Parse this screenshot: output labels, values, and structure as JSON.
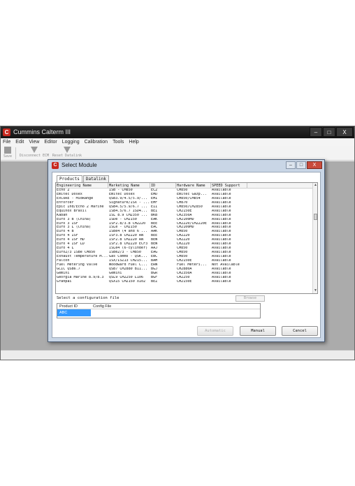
{
  "app": {
    "title": "Cummins Calterm III",
    "window_buttons": {
      "minimize": "‒",
      "maximize": "□",
      "close": "X"
    }
  },
  "menu": [
    "File",
    "Edit",
    "View",
    "Editor",
    "Logging",
    "Calibration",
    "Tools",
    "Help"
  ],
  "toolbar": {
    "save_label": "Save",
    "disconnect_label": "Disconnect ECM",
    "reset_label": "Reset Datalink"
  },
  "dialog": {
    "title": "Select Module",
    "tabs": [
      "Products",
      "Datalink"
    ],
    "columns": [
      "Engineering Name",
      "Marketing Name",
      "ID",
      "Hardware Name",
      "SPEED Support"
    ],
    "rows": [
      [
        "Echo 2",
        "ISB - CM850",
        "EC2",
        "CM850",
        "Available"
      ],
      [
        "Emitec Dosex",
        "Emitec Dosex",
        "EMD",
        "Emitec Gazp...",
        "Available"
      ],
      [
        "ExCORE - MidRange",
        "QSB3.9/4.5/5.9/...",
        "EMI",
        "CM850/CM854",
        "Available"
      ],
      [
        "Enforcer",
        "Signature/ISX - ...",
        "EMF",
        "CM870",
        "Available"
      ],
      [
        "Epic Ind/Echo 2 Marine",
        "QSB4.5/5.9/6.7 ...",
        "EII",
        "CM850/CM2850",
        "Available"
      ],
      [
        "Equinox Brasil",
        "ISB4.5/6.7 ISD4...",
        "BEI",
        "CM2150E",
        "Available"
      ],
      [
        "Kaban",
        "ISL 8.9 CM2350 ...",
        "BKB",
        "CM2350A",
        "Available"
      ],
      [
        "Euro 3 B (China)",
        "ISDe - CM2150",
        "EAK",
        "CM2100MD",
        "Available"
      ],
      [
        "Euro 3 ISF",
        "ISF2.8/3.8 CM2220",
        "BEE",
        "CM2220/CM2220E",
        "Available"
      ],
      [
        "Euro 3 L (China)",
        "ISLe - CM2150",
        "EAC",
        "CM2100MD",
        "Available"
      ],
      [
        "Euro 4 B",
        "ISBe4 (4 and 6 ...",
        "AAK",
        "CM850",
        "Available"
      ],
      [
        "Euro 4 ISF",
        "ISF3.8 CM2220 AN",
        "BEE",
        "CM2220",
        "Available"
      ],
      [
        "Euro 4 ISF HD",
        "ISF2.8 CM2220 AN",
        "BEW",
        "CM2220",
        "Available"
      ],
      [
        "Euro 4 ISF LD",
        "ISF2.8 CM2220 ECF3",
        "BEW",
        "CM2220",
        "Available"
      ],
      [
        "Euro 4 L",
        "ISLe4 (6-cylinder)",
        "AAJ",
        "CM850",
        "Available"
      ],
      [
        "Euro2/3 ISBe CM850",
        "ISBe2/3 - CM850",
        "EAG",
        "CM850",
        "Available"
      ],
      [
        "Exhaust Temperature M...",
        "Gas Comms - QSK...",
        "EBC",
        "CM850",
        "Available"
      ],
      [
        "Falcon",
        "ISX/ISZ13 CM215...",
        "BAM",
        "CM2150E",
        "Available"
      ],
      [
        "Fuel Metering Valve",
        "Woodward Fuel C...",
        "ERW",
        "Fuel Meteri...",
        "Not Available"
      ],
      [
        "GCIC QSB6.7",
        "QSB7 CM2880 B11...",
        "BGJ",
        "CM2880A",
        "Available"
      ],
      [
        "Gemini",
        "Gemini",
        "BGR",
        "CM2350A",
        "Available"
      ],
      [
        "Georgia Marine 8.9/8.3",
        "QSL9 CM2250 L106",
        "BGF",
        "CM2250",
        "Available"
      ],
      [
        "Granpai",
        "QSX15 CM2150 X102",
        "BEZ",
        "CM2150E",
        "Available"
      ]
    ],
    "config_prompt": "Select a configuration file",
    "browse_label": "Browse",
    "config_columns": [
      "Product ID",
      "Config File"
    ],
    "config_rows": [
      [
        "ABC",
        ""
      ]
    ],
    "buttons": {
      "automatic": "Automatic",
      "manual": "Manual",
      "cancel": "Cancel"
    }
  }
}
